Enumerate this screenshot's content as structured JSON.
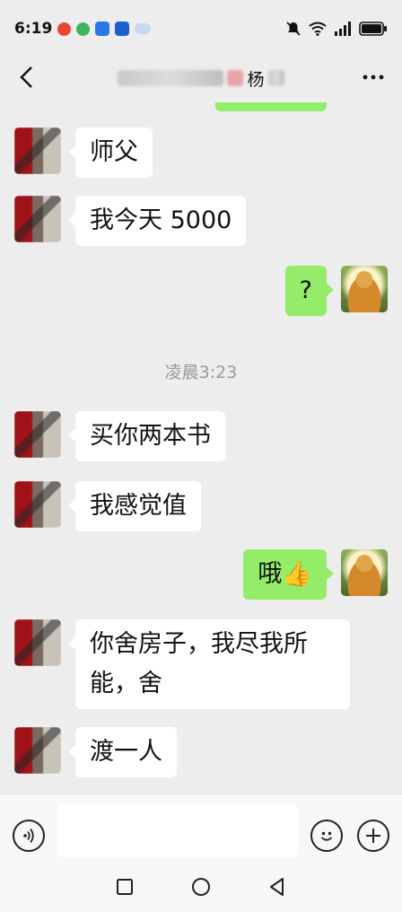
{
  "status_bar": {
    "time": "6:19",
    "notification_icons": [
      "weibo-icon",
      "green-app-icon",
      "blue-app-icon",
      "blue-app-icon-2",
      "cloud-icon"
    ],
    "right_icons": [
      "mute-icon",
      "wifi-icon",
      "signal-icon",
      "battery-icon"
    ]
  },
  "header": {
    "title_visible_char": "杨",
    "back_icon": "chevron-left-icon",
    "more_icon": "more-dots-icon"
  },
  "messages": [
    {
      "side": "left",
      "text": "师父"
    },
    {
      "side": "left",
      "text": "我今天 5000"
    },
    {
      "side": "right",
      "text": "?"
    },
    {
      "side": "left",
      "text": "买你两本书"
    },
    {
      "side": "left",
      "text": "我感觉值"
    },
    {
      "side": "right",
      "text": "哦",
      "emoji": "👍"
    },
    {
      "side": "left",
      "text": "你舍房子，我尽我所能，舍"
    },
    {
      "side": "left",
      "text": "渡一人"
    }
  ],
  "timestamp": "凌晨3:23",
  "input_bar": {
    "voice_icon": "voice-icon",
    "emoji_icon": "emoji-icon",
    "plus_icon": "plus-icon",
    "value": ""
  },
  "nav": {
    "recent_icon": "square-icon",
    "home_icon": "circle-icon",
    "back_icon": "triangle-back-icon"
  },
  "colors": {
    "background": "#ededed",
    "sent_bubble": "#95ec69",
    "received_bubble": "#ffffff",
    "timestamp": "#999999"
  }
}
